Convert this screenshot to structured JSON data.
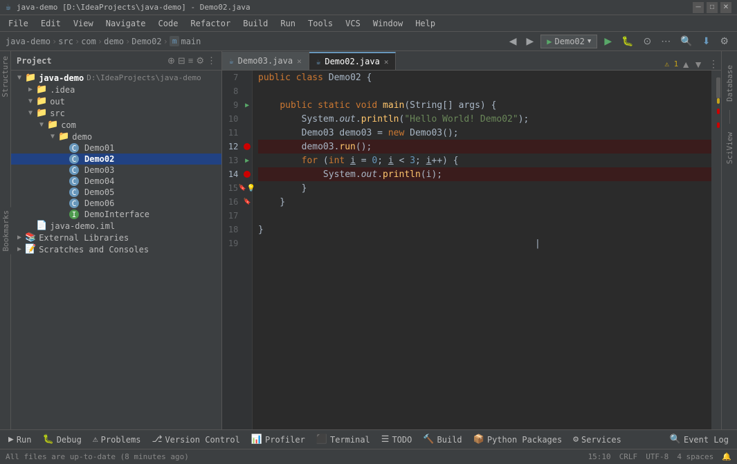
{
  "titleBar": {
    "title": "java-demo [D:\\IdeaProjects\\java-demo] - Demo02.java",
    "minBtn": "─",
    "maxBtn": "□",
    "closeBtn": "✕"
  },
  "menuBar": {
    "items": [
      "java-demo",
      "File",
      "Edit",
      "View",
      "Navigate",
      "Code",
      "Refactor",
      "Build",
      "Run",
      "Tools",
      "VCS",
      "Window",
      "Help"
    ]
  },
  "navBar": {
    "breadcrumbs": [
      "java-demo",
      "src",
      "com",
      "demo",
      "Demo02",
      "main"
    ],
    "runConfig": "Demo02",
    "searchIcon": "🔍",
    "updateIcon": "⬇"
  },
  "projectPanel": {
    "title": "Project",
    "items": [
      {
        "label": "java-demo",
        "sublabel": "D:\\IdeaProjects\\java-demo",
        "type": "root",
        "indent": 0,
        "expanded": true
      },
      {
        "label": ".idea",
        "type": "folder",
        "indent": 1,
        "expanded": false
      },
      {
        "label": "out",
        "type": "folder",
        "indent": 1,
        "expanded": true,
        "selected": false
      },
      {
        "label": "src",
        "type": "folder",
        "indent": 1,
        "expanded": true
      },
      {
        "label": "com",
        "type": "folder",
        "indent": 2,
        "expanded": true
      },
      {
        "label": "demo",
        "type": "folder",
        "indent": 3,
        "expanded": true
      },
      {
        "label": "Demo01",
        "type": "java",
        "indent": 4
      },
      {
        "label": "Demo02",
        "type": "java",
        "indent": 4,
        "selected": true
      },
      {
        "label": "Demo03",
        "type": "java",
        "indent": 4
      },
      {
        "label": "Demo04",
        "type": "java",
        "indent": 4
      },
      {
        "label": "Demo05",
        "type": "java",
        "indent": 4
      },
      {
        "label": "Demo06",
        "type": "java",
        "indent": 4
      },
      {
        "label": "DemoInterface",
        "type": "java-interface",
        "indent": 4
      },
      {
        "label": "java-demo.iml",
        "type": "iml",
        "indent": 1
      },
      {
        "label": "External Libraries",
        "type": "ext",
        "indent": 0,
        "expanded": false
      },
      {
        "label": "Scratches and Consoles",
        "type": "ext",
        "indent": 0,
        "expanded": false
      }
    ]
  },
  "tabs": [
    {
      "label": "Demo03.java",
      "active": false,
      "modified": false
    },
    {
      "label": "Demo02.java",
      "active": true,
      "modified": false
    }
  ],
  "editor": {
    "lines": [
      {
        "num": "7",
        "content": "",
        "type": "plain",
        "hasRunArrow": false,
        "hasBreakpoint": false,
        "hasBulb": false
      },
      {
        "num": "8",
        "content": "",
        "type": "plain"
      },
      {
        "num": "9",
        "content": "    public static void main(String[] args) {",
        "type": "code",
        "hasRunArrow": true
      },
      {
        "num": "10",
        "content": "        System.out.println(\"Hello World! Demo02\");",
        "type": "code"
      },
      {
        "num": "11",
        "content": "        Demo03 demo03 = new Demo03();",
        "type": "code"
      },
      {
        "num": "12",
        "content": "        demo03.run();",
        "type": "code",
        "hasBreakpoint": true,
        "highlighted": true
      },
      {
        "num": "13",
        "content": "        for (int i = 0; i < 3; i++) {",
        "type": "code",
        "hasRunArrow": true
      },
      {
        "num": "14",
        "content": "            System.out.println(i);",
        "type": "code",
        "hasBreakpoint": true,
        "highlighted": true
      },
      {
        "num": "15",
        "content": "        }",
        "type": "code",
        "hasBulb": true,
        "hasBookmark": true
      },
      {
        "num": "16",
        "content": "    }",
        "type": "code",
        "hasBookmark": true
      },
      {
        "num": "17",
        "content": "",
        "type": "plain"
      },
      {
        "num": "18",
        "content": "}",
        "type": "code"
      },
      {
        "num": "19",
        "content": "",
        "type": "plain"
      }
    ]
  },
  "statusBar": {
    "leftText": "All files are up-to-date (8 minutes ago)",
    "position": "15:10",
    "lineEnding": "CRLF",
    "encoding": "UTF-8",
    "indent": "4 spaces"
  },
  "bottomToolbar": {
    "items": [
      {
        "label": "Run",
        "icon": "▶"
      },
      {
        "label": "Debug",
        "icon": "🐛"
      },
      {
        "label": "Problems",
        "icon": "⚠"
      },
      {
        "label": "Version Control",
        "icon": "⎇"
      },
      {
        "label": "Profiler",
        "icon": "📊"
      },
      {
        "label": "Terminal",
        "icon": "⬛"
      },
      {
        "label": "TODO",
        "icon": "☰"
      },
      {
        "label": "Build",
        "icon": "🔨"
      },
      {
        "label": "Python Packages",
        "icon": "📦"
      },
      {
        "label": "Services",
        "icon": "⚙"
      },
      {
        "label": "Event Log",
        "icon": "🔍"
      }
    ]
  },
  "rightPanels": {
    "database": "Database",
    "sqm": "SciView"
  }
}
